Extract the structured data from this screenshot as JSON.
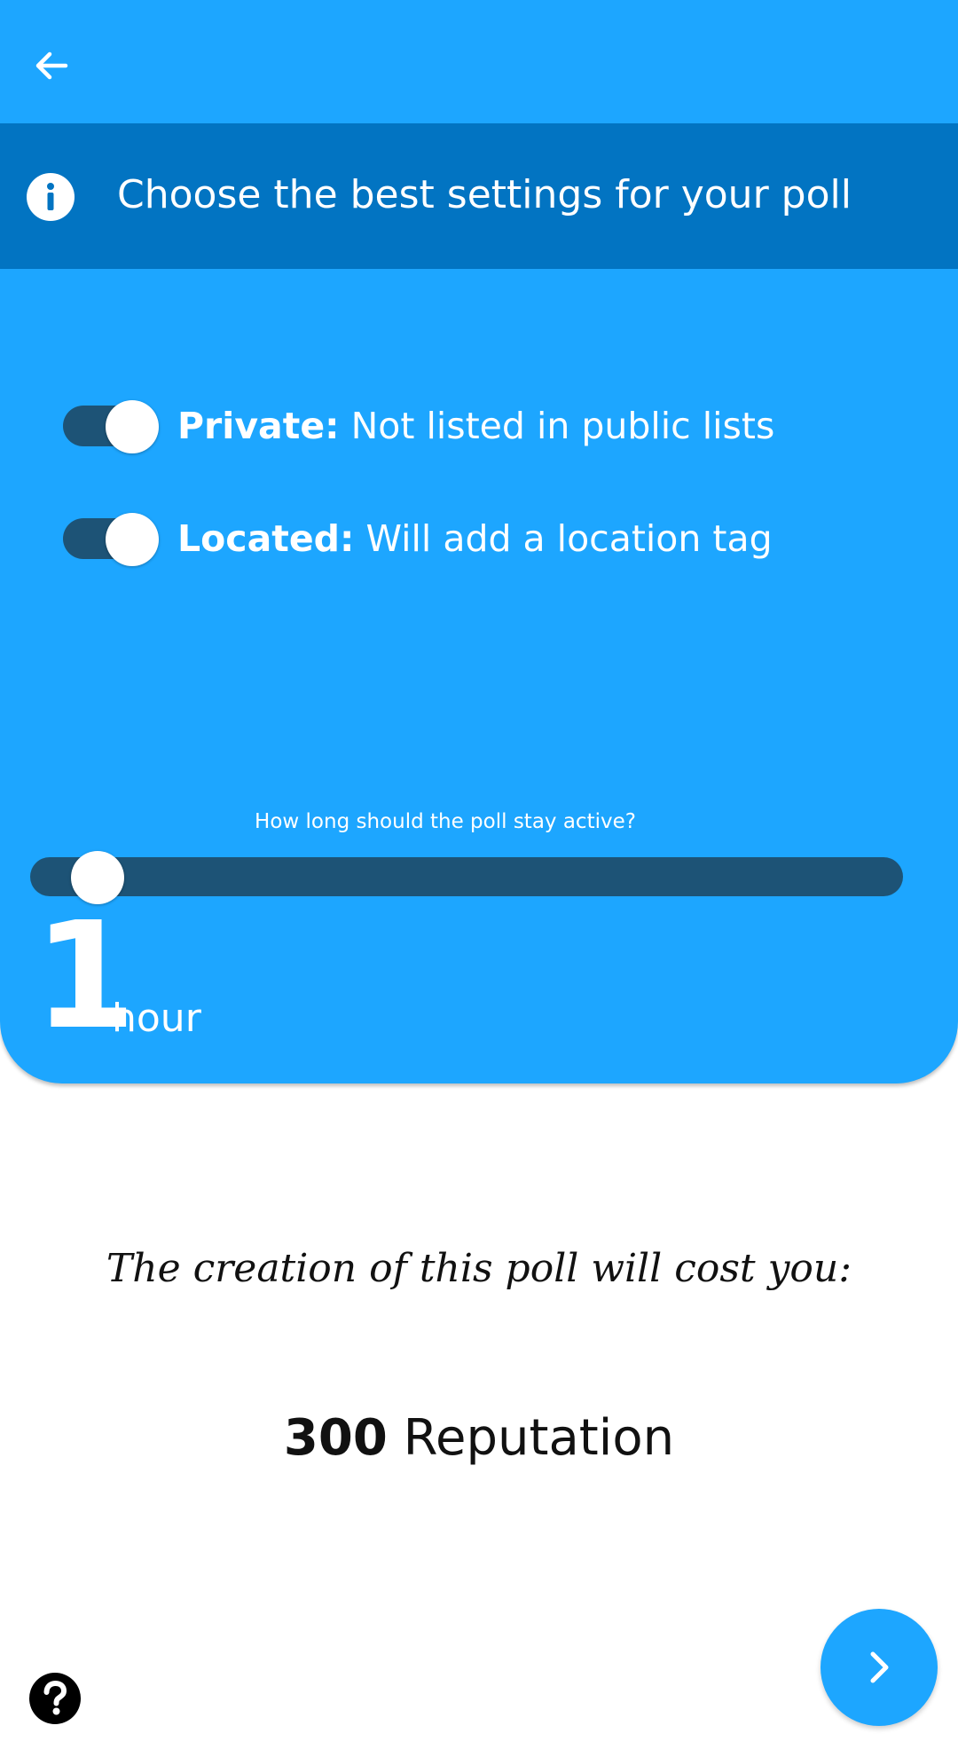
{
  "appbar": {
    "back_icon": "arrow-left-icon"
  },
  "info_banner": {
    "icon": "info-icon",
    "text": "Choose the best settings for your poll"
  },
  "settings": {
    "toggles": [
      {
        "title": "Private:",
        "description": "Not listed in public lists",
        "on": true
      },
      {
        "title": "Located:",
        "description": "Will add a location tag",
        "on": true
      }
    ],
    "duration": {
      "question": "How long should the poll stay active?",
      "value": "1",
      "unit": "hour",
      "slider_fraction": 0.05
    }
  },
  "cost": {
    "caption": "The creation of this poll will cost you:",
    "amount": "300",
    "currency": "Reputation"
  },
  "help": {
    "icon": "question-circle-icon"
  },
  "next": {
    "icon": "chevron-right-icon"
  },
  "colors": {
    "primary": "#1da6ff",
    "banner": "#0274c2",
    "track": "#1d5376",
    "text_dark": "#111111"
  }
}
